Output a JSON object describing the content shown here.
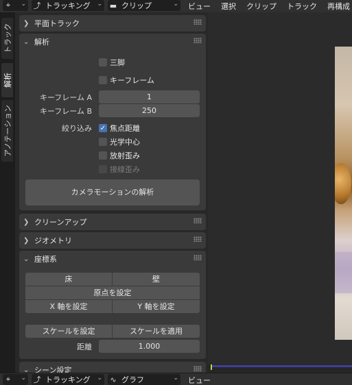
{
  "top_header": {
    "mode": "トラッキング",
    "view_type": "クリップ",
    "menus": [
      "ビュー",
      "選択",
      "クリップ",
      "トラック",
      "再構成"
    ]
  },
  "bottom_header": {
    "mode": "トラッキング",
    "view_type": "グラフ",
    "menus": [
      "ビュー"
    ]
  },
  "tabs": [
    "トラック",
    "解析",
    "アノテーション"
  ],
  "panels": {
    "plane_track": {
      "title": "平面トラック"
    },
    "solve": {
      "title": "解析",
      "tripod": {
        "label": "三脚",
        "checked": false
      },
      "keyframe": {
        "label": "キーフレーム",
        "checked": false
      },
      "keyframe_a": {
        "label": "キーフレーム A",
        "value": "1"
      },
      "keyframe_b": {
        "label": "キーフレーム B",
        "value": "250"
      },
      "refine_label": "絞り込み",
      "focal_length": {
        "label": "焦点距離",
        "checked": true
      },
      "optical_center": {
        "label": "光学中心",
        "checked": false
      },
      "radial_distortion": {
        "label": "放射歪み",
        "checked": false
      },
      "tangential_distortion": {
        "label": "接線歪み",
        "checked": false,
        "disabled": true
      },
      "solve_button": "カメラモーションの解析"
    },
    "cleanup": {
      "title": "クリーンアップ"
    },
    "geometry": {
      "title": "ジオメトリ"
    },
    "orientation": {
      "title": "座標系",
      "floor": "床",
      "wall": "壁",
      "set_origin": "原点を設定",
      "set_x_axis": "X 軸を設定",
      "set_y_axis": "Y 軸を設定",
      "set_scale": "スケールを設定",
      "apply_scale": "スケールを適用",
      "distance_label": "距離",
      "distance_value": "1.000"
    },
    "scene_setup": {
      "title": "シーン設定"
    }
  },
  "colors": {
    "accent": "#4772b3",
    "panel": "#3a3a3a",
    "button": "#545454"
  }
}
